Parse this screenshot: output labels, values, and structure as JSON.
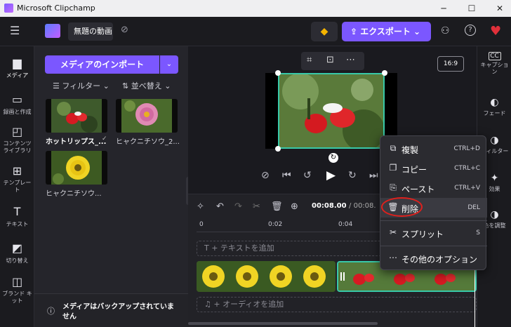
{
  "window": {
    "title": "Microsoft Clipchamp",
    "minimize": "─",
    "maximize": "☐",
    "close": "✕"
  },
  "toolbar": {
    "menu_icon": "☰",
    "project_name": "無題の動画",
    "cloud_off_icon": "⊘",
    "premium_icon": "◆",
    "export_label": "⇪ エクスポート ⌄",
    "share_icon": "⚇",
    "help_icon": "?",
    "heart_icon": "♥"
  },
  "left_rail": [
    {
      "label": "メディア",
      "icon": "▆"
    },
    {
      "label": "録画と作成",
      "icon": "▭"
    },
    {
      "label": "コンテンツ ライブラリ",
      "icon": "◰"
    },
    {
      "label": "テンプレート",
      "icon": "⊞"
    },
    {
      "label": "テキスト",
      "icon": "T"
    },
    {
      "label": "切り替え",
      "icon": "◩"
    },
    {
      "label": "ブランド キット",
      "icon": "◫"
    }
  ],
  "media": {
    "import_label": "メディアのインポート",
    "import_dropdown": "⌄",
    "filter_label": "フィルター ⌄",
    "sort_label": "並べ替え ⌄",
    "items": [
      {
        "label": "ホットリップス_..."
      },
      {
        "label": "ヒャクニチソウ_2..."
      },
      {
        "label": "ヒャクニチソウ..."
      }
    ],
    "backup_text": "メディアはバックアップされていません",
    "backup_icon": "ⓘ",
    "backup_chevron": "⌃"
  },
  "preview": {
    "aspect_ratio": "16:9",
    "crop_icon": "⌗",
    "fit_icon": "⊡",
    "more_icon": "⋯",
    "rotate_icon": "↻",
    "controls": [
      "⊘",
      "⏮",
      "↺",
      "▶",
      "↻",
      "⏭"
    ]
  },
  "right_rail": [
    {
      "label": "キャプション",
      "icon": "CC"
    },
    {
      "label": "フェード",
      "icon": "◐"
    },
    {
      "label": "フィルター",
      "icon": "◑"
    },
    {
      "label": "効果",
      "icon": "✦"
    },
    {
      "label": "色を調整",
      "icon": "◑"
    }
  ],
  "timeline": {
    "timecode_current": "00:08.00",
    "timecode_total": "/ 00:08.",
    "ruler": [
      "0",
      "0:02",
      "0:04"
    ],
    "text_track": "T  + テキストを追加",
    "audio_track": "♫  + オーディオを追加",
    "tools": [
      "✧",
      "↶",
      "↷",
      "✂",
      "🗑",
      "⊕"
    ]
  },
  "context_menu": [
    {
      "icon": "⧉",
      "label": "複製",
      "shortcut": "CTRL+D"
    },
    {
      "icon": "❐",
      "label": "コピー",
      "shortcut": "CTRL+C"
    },
    {
      "icon": "⎘",
      "label": "ペースト",
      "shortcut": "CTRL+V"
    },
    {
      "icon": "🗑",
      "label": "削除",
      "shortcut": "DEL"
    },
    {
      "icon": "✂",
      "label": "スプリット",
      "shortcut": "S"
    },
    {
      "icon": "⋯",
      "label": "その他のオプション",
      "shortcut": ""
    }
  ],
  "colors": {
    "accent": "#7b57ff",
    "selection": "#38c8a8",
    "highlight_circle": "#e0201c"
  }
}
